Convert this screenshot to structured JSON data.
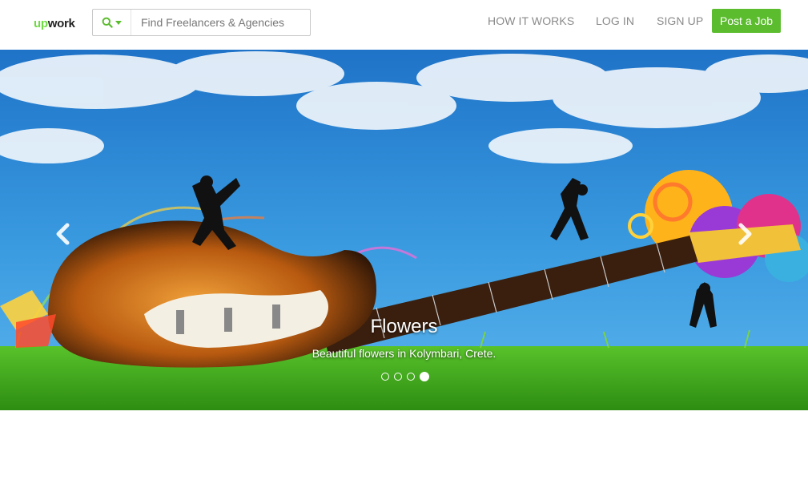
{
  "header": {
    "logo": {
      "up": "up",
      "work": "work"
    },
    "search": {
      "placeholder": "Find Freelancers & Agencies",
      "value": ""
    },
    "nav": {
      "how_it_works": "HOW IT WORKS",
      "log_in": "LOG IN",
      "sign_up": "SIGN UP",
      "post_job": "Post a Job"
    }
  },
  "carousel": {
    "caption_title": "Flowers",
    "caption_text": "Beautiful flowers in Kolymbari, Crete.",
    "slide_count": 4,
    "active_index": 3,
    "prev_icon": "chevron-left-icon",
    "next_icon": "chevron-right-icon"
  },
  "colors": {
    "brand_green": "#6fda44",
    "button_green": "#5bbc2e",
    "nav_text": "#8a8a8a",
    "sky_blue": "#2f8fd8",
    "grass_green": "#3aa515"
  }
}
